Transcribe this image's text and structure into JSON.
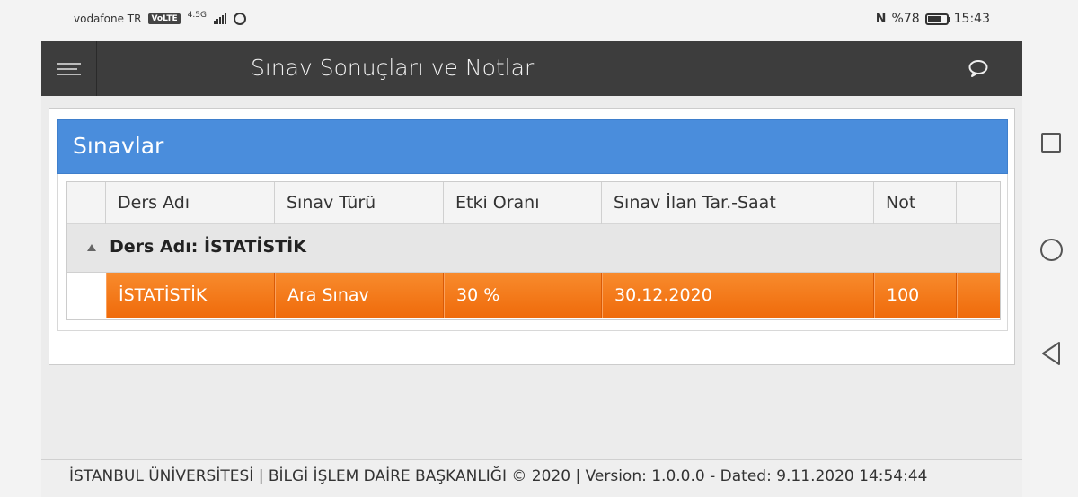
{
  "statusbar": {
    "carrier": "vodafone TR",
    "volte": "VoLTE",
    "network": "4.5G",
    "battery_percent": 78,
    "battery_label": "%78",
    "time": "15:43"
  },
  "appbar": {
    "title": "Sınav Sonuçları ve Notlar"
  },
  "panel": {
    "title": "Sınavlar"
  },
  "table": {
    "columns": [
      "Ders Adı",
      "Sınav Türü",
      "Etki Oranı",
      "Sınav İlan Tar.-Saat",
      "Not"
    ],
    "group_label": "Ders Adı: İSTATİSTİK",
    "rows": [
      [
        "İSTATİSTİK",
        "Ara Sınav",
        "30 %",
        "30.12.2020",
        "100"
      ]
    ]
  },
  "footer": {
    "text": "İSTANBUL ÜNİVERSİTESİ | BİLGİ İŞLEM DAİRE BAŞKANLIĞI © 2020 |     Version: 1.0.0.0 - Dated: 9.11.2020 14:54:44"
  },
  "colors": {
    "appbar": "#3d3d3d",
    "panel_header": "#4a8ddc",
    "selected_row": "#f47c1e"
  }
}
